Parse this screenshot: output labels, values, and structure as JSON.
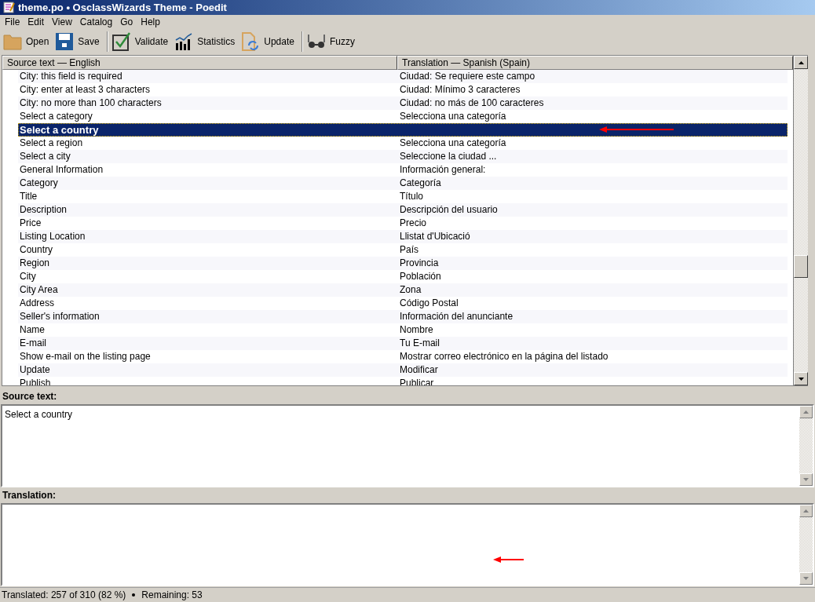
{
  "window": {
    "title": "theme.po • OsclassWizards Theme - Poedit"
  },
  "menu": [
    "File",
    "Edit",
    "View",
    "Catalog",
    "Go",
    "Help"
  ],
  "toolbar": [
    [
      "Open",
      "Save"
    ],
    [
      "Validate",
      "Statistics",
      "Update"
    ],
    [
      "Fuzzy"
    ]
  ],
  "table": {
    "columns": [
      "Source text — English",
      "Translation — Spanish (Spain)"
    ],
    "rows": [
      {
        "source": "City: this field is required",
        "translation": "Ciudad: Se requiere este campo",
        "selected": false
      },
      {
        "source": "City: enter at least 3 characters",
        "translation": "Ciudad: Mínimo 3 caracteres",
        "selected": false
      },
      {
        "source": "City: no more than 100 characters",
        "translation": "Ciudad: no más de 100 caracteres",
        "selected": false
      },
      {
        "source": "Select a category",
        "translation": "Selecciona una categoría",
        "selected": false
      },
      {
        "source": "Select a country",
        "selected": true
      },
      {
        "source": "Select a region",
        "translation": "Selecciona una categoría",
        "selected": false
      },
      {
        "source": "Select a city",
        "translation": "Seleccione la ciudad ...",
        "selected": false
      },
      {
        "source": "General Information",
        "translation": "Información general:",
        "selected": false
      },
      {
        "source": "Category",
        "translation": "Categoría",
        "selected": false
      },
      {
        "source": "Title",
        "translation": "Título",
        "selected": false
      },
      {
        "source": "Description",
        "translation": "Descripción del usuario",
        "selected": false
      },
      {
        "source": "Price",
        "translation": "Precio",
        "selected": false
      },
      {
        "source": "Listing Location",
        "translation": "Llistat d'Ubicació",
        "selected": false
      },
      {
        "source": "Country",
        "translation": "País",
        "selected": false
      },
      {
        "source": "Region",
        "translation": "Provincia",
        "selected": false
      },
      {
        "source": "City",
        "translation": "Población",
        "selected": false
      },
      {
        "source": "City Area",
        "translation": "Zona",
        "selected": false
      },
      {
        "source": "Address",
        "translation": "Código Postal",
        "selected": false
      },
      {
        "source": "Seller's information",
        "translation": "Información del anunciante",
        "selected": false
      },
      {
        "source": "Name",
        "translation": "Nombre",
        "selected": false
      },
      {
        "source": "E-mail",
        "translation": "Tu E-mail",
        "selected": false
      },
      {
        "source": "Show e-mail on the listing page",
        "translation": "Mostrar correo electrónico en la página del listado",
        "selected": false
      },
      {
        "source": "Update",
        "translation": "Modificar",
        "selected": false
      },
      {
        "source": "Publish",
        "translation": "Publicar",
        "selected": false
      }
    ]
  },
  "source_panel": {
    "label": "Source text:",
    "text": "Select a country"
  },
  "translation_panel": {
    "label": "Translation:"
  },
  "status_bar": {
    "translated": "Translated: 257 of 310 (82 %)",
    "remaining": "Remaining: 53"
  }
}
